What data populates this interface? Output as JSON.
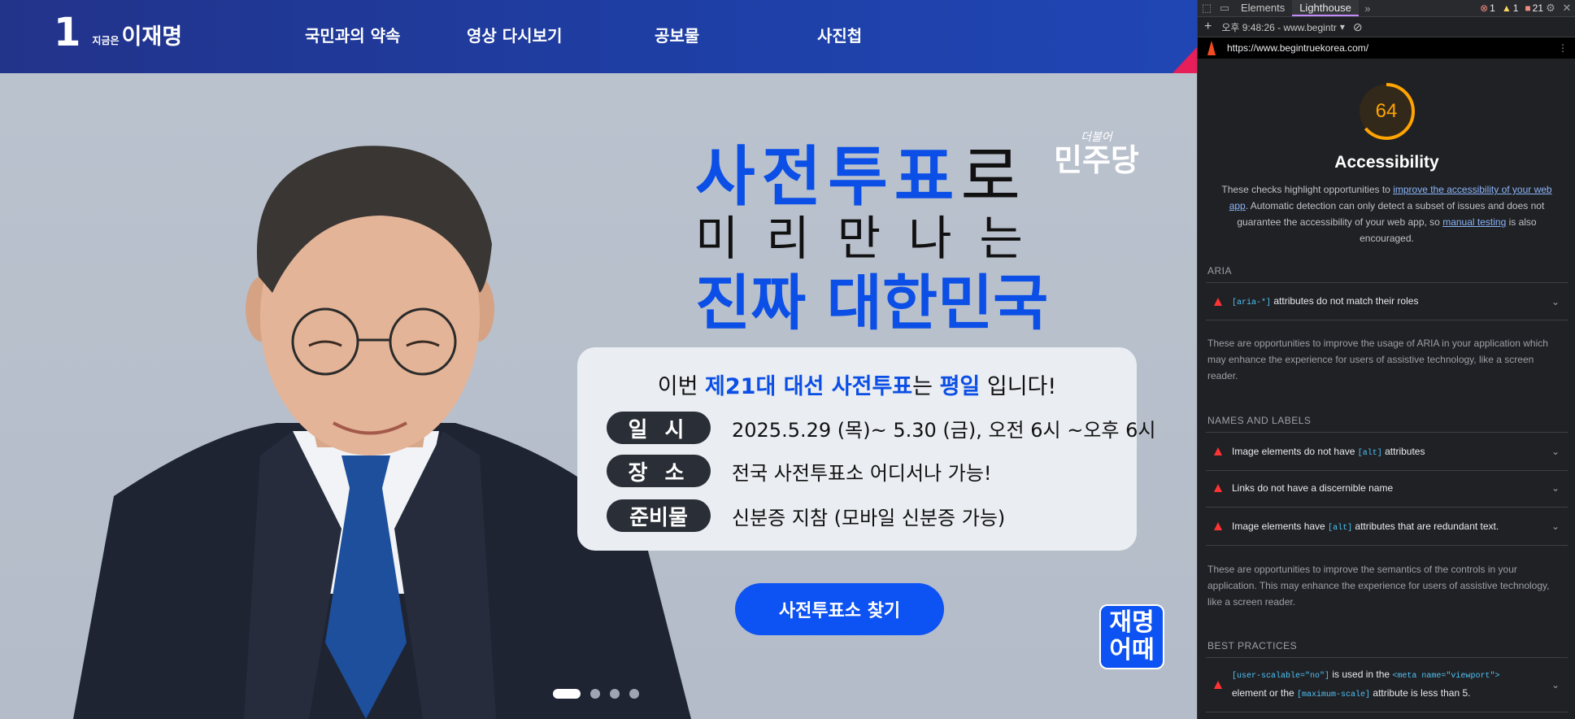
{
  "site": {
    "logo": {
      "number": "1",
      "small": "지금은",
      "name": "이재명"
    },
    "nav": [
      "국민과의 약속",
      "영상 다시보기",
      "공보물",
      "사진첩"
    ],
    "headline": {
      "line1_blue": "사전투표",
      "line1_plain": "로",
      "line2": "미리만나는",
      "line3": "진짜 대한민국"
    },
    "party": {
      "small": "더불어",
      "big": "민주당"
    },
    "info": {
      "title_pre": "이번 ",
      "title_b1": "제21대 대선 사전투표",
      "title_mid": "는 ",
      "title_b2": "평일",
      "title_post": " 입니다!",
      "rows": [
        {
          "label": "일 시",
          "text": "2025.5.29 (목)~ 5.30 (금), 오전 6시 ~오후 6시"
        },
        {
          "label": "장 소",
          "text": "전국 사전투표소 어디서나 가능!"
        },
        {
          "label": "준비물",
          "text": "신분증 지참  (모바일 신분증 가능)"
        }
      ]
    },
    "find_button": "사전투표소 찾기",
    "badge": {
      "line1": "재명",
      "line2": "어때"
    },
    "slides": {
      "count": 4,
      "active": 1
    }
  },
  "devtools": {
    "tabs": [
      "Elements",
      "Lighthouse"
    ],
    "active_tab": "Lighthouse",
    "counts": {
      "errors": "1",
      "warnings": "1",
      "messages": "21"
    },
    "report_selector": "오후 9:48:26 - www.begintr",
    "url": "https://www.begintruekorea.com/",
    "score": "64",
    "score_color": "#ffa400",
    "category": "Accessibility",
    "description": {
      "p1": "These checks highlight opportunities to ",
      "link1": "improve the accessibility of your web app",
      "p2": ". Automatic detection can only detect a subset of issues and does not guarantee the accessibility of your web app, so ",
      "link2": "manual testing",
      "p3": " is also encouraged."
    },
    "sections": {
      "aria": {
        "title": "ARIA",
        "audit_code": "[aria-*]",
        "audit_text": " attributes do not match their roles",
        "note": "These are opportunities to improve the usage of ARIA in your application which may enhance the experience for users of assistive technology, like a screen reader."
      },
      "names": {
        "title": "NAMES AND LABELS",
        "audits": [
          {
            "pre": "Image elements do not have ",
            "code": "[alt]",
            "post": " attributes"
          },
          {
            "pre": "Links do not have a discernible name",
            "code": "",
            "post": ""
          },
          {
            "pre": "Image elements have ",
            "code": "[alt]",
            "post": " attributes that are redundant text."
          }
        ],
        "note": "These are opportunities to improve the semantics of the controls in your application. This may enhance the experience for users of assistive technology, like a screen reader."
      },
      "best": {
        "title": "BEST PRACTICES",
        "code1": "[user-scalable=\"no\"]",
        "text1": " is used in the ",
        "code2": "<meta name=\"viewport\">",
        "text2": "element or the ",
        "code3": "[maximum-scale]",
        "text3": " attribute is less than 5."
      }
    }
  }
}
